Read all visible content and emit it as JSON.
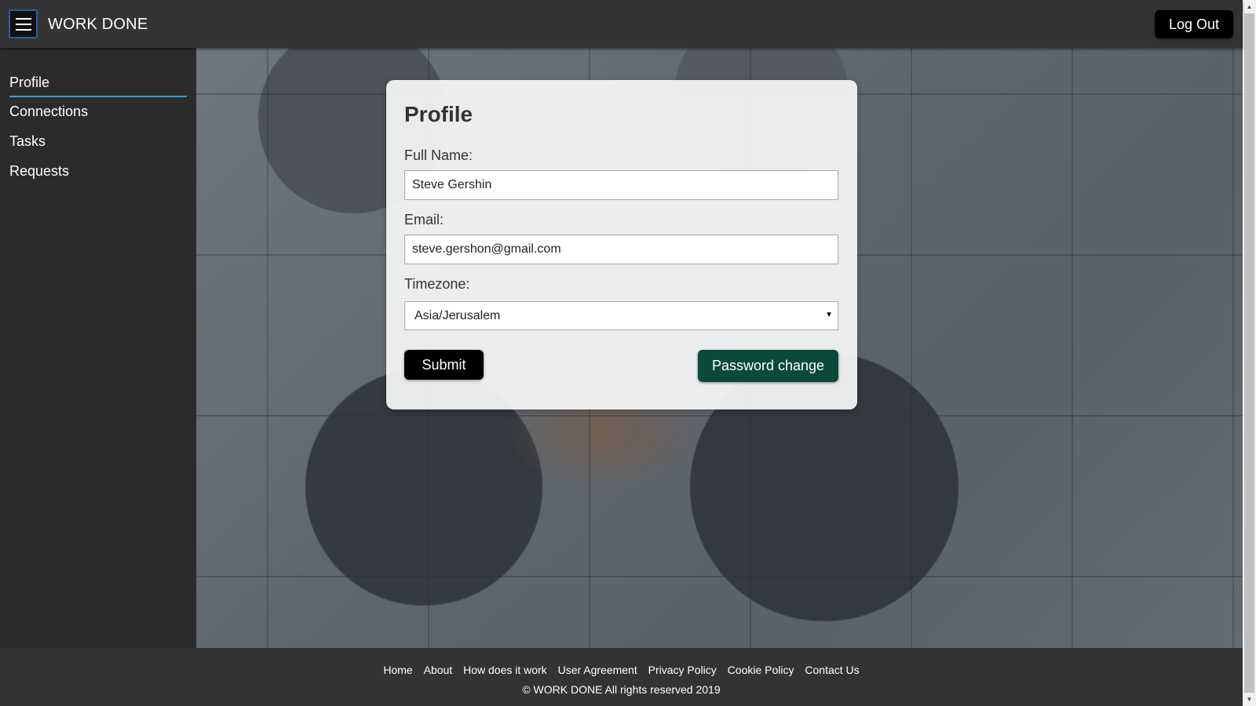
{
  "header": {
    "menu_icon": "hamburger-menu-icon",
    "title": "WORK DONE",
    "logout_label": "Log Out"
  },
  "sidebar": {
    "items": [
      {
        "label": "Profile",
        "active": true
      },
      {
        "label": "Connections",
        "active": false
      },
      {
        "label": "Tasks",
        "active": false
      },
      {
        "label": "Requests",
        "active": false
      }
    ],
    "active_underline_color": "#2d9fd8"
  },
  "profile_form": {
    "title": "Profile",
    "full_name_label": "Full Name:",
    "full_name_value": "Steve Gershin",
    "email_label": "Email:",
    "email_value": "steve.gershon@gmail.com",
    "timezone_label": "Timezone:",
    "timezone_value": "Asia/Jerusalem",
    "submit_label": "Submit",
    "password_change_label": "Password change",
    "password_button_color": "#0b4a3a"
  },
  "footer": {
    "links": [
      "Home",
      "About",
      "How does it work",
      "User Agreement",
      "Privacy Policy",
      "Cookie Policy",
      "Contact Us"
    ],
    "copyright": "© WORK DONE All rights reserved 2019"
  }
}
